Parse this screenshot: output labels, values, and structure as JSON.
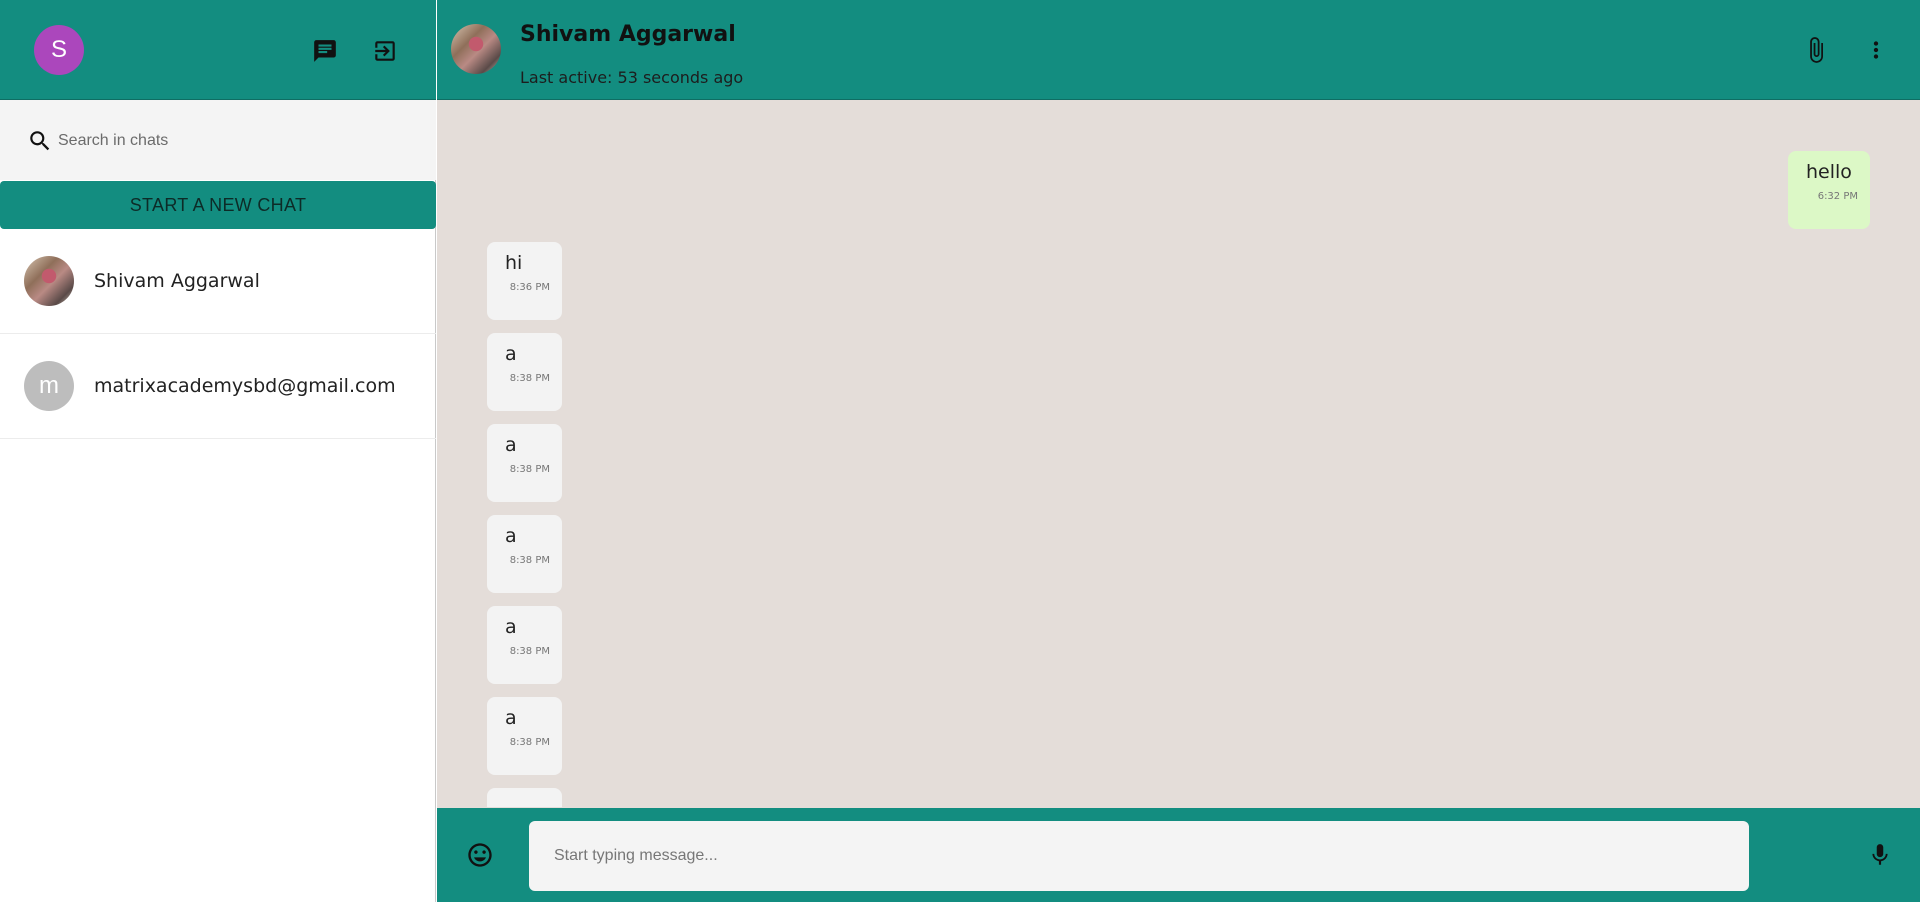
{
  "sidebar": {
    "user_avatar_letter": "S",
    "search": {
      "placeholder": "Search in chats",
      "value": ""
    },
    "new_chat_label": "START A NEW CHAT",
    "chats": [
      {
        "name": "Shivam Aggarwal",
        "avatar": "photo"
      },
      {
        "name": "matrixacademysbd@gmail.com",
        "avatar_letter": "m"
      }
    ]
  },
  "chat": {
    "contact_name": "Shivam Aggarwal",
    "last_active": "Last active: 53 seconds ago",
    "messages": [
      {
        "text": "hello",
        "time": "6:32 PM",
        "direction": "sent"
      },
      {
        "text": "hi",
        "time": "8:36 PM",
        "direction": "received"
      },
      {
        "text": "a",
        "time": "8:38 PM",
        "direction": "received"
      },
      {
        "text": "a",
        "time": "8:38 PM",
        "direction": "received"
      },
      {
        "text": "a",
        "time": "8:38 PM",
        "direction": "received"
      },
      {
        "text": "a",
        "time": "8:38 PM",
        "direction": "received"
      },
      {
        "text": "a",
        "time": "8:38 PM",
        "direction": "received"
      }
    ],
    "composer": {
      "placeholder": "Start typing message...",
      "value": ""
    }
  },
  "colors": {
    "header": "#138d80",
    "chat_background": "#e4ddd9",
    "sent_bubble": "#dcf8c6",
    "received_bubble": "#f3f3f3",
    "user_avatar": "#ab47bc"
  },
  "icons": [
    "chat-icon",
    "logout-icon",
    "search-icon",
    "attach-icon",
    "more-vert-icon",
    "emoji-icon",
    "mic-icon"
  ]
}
